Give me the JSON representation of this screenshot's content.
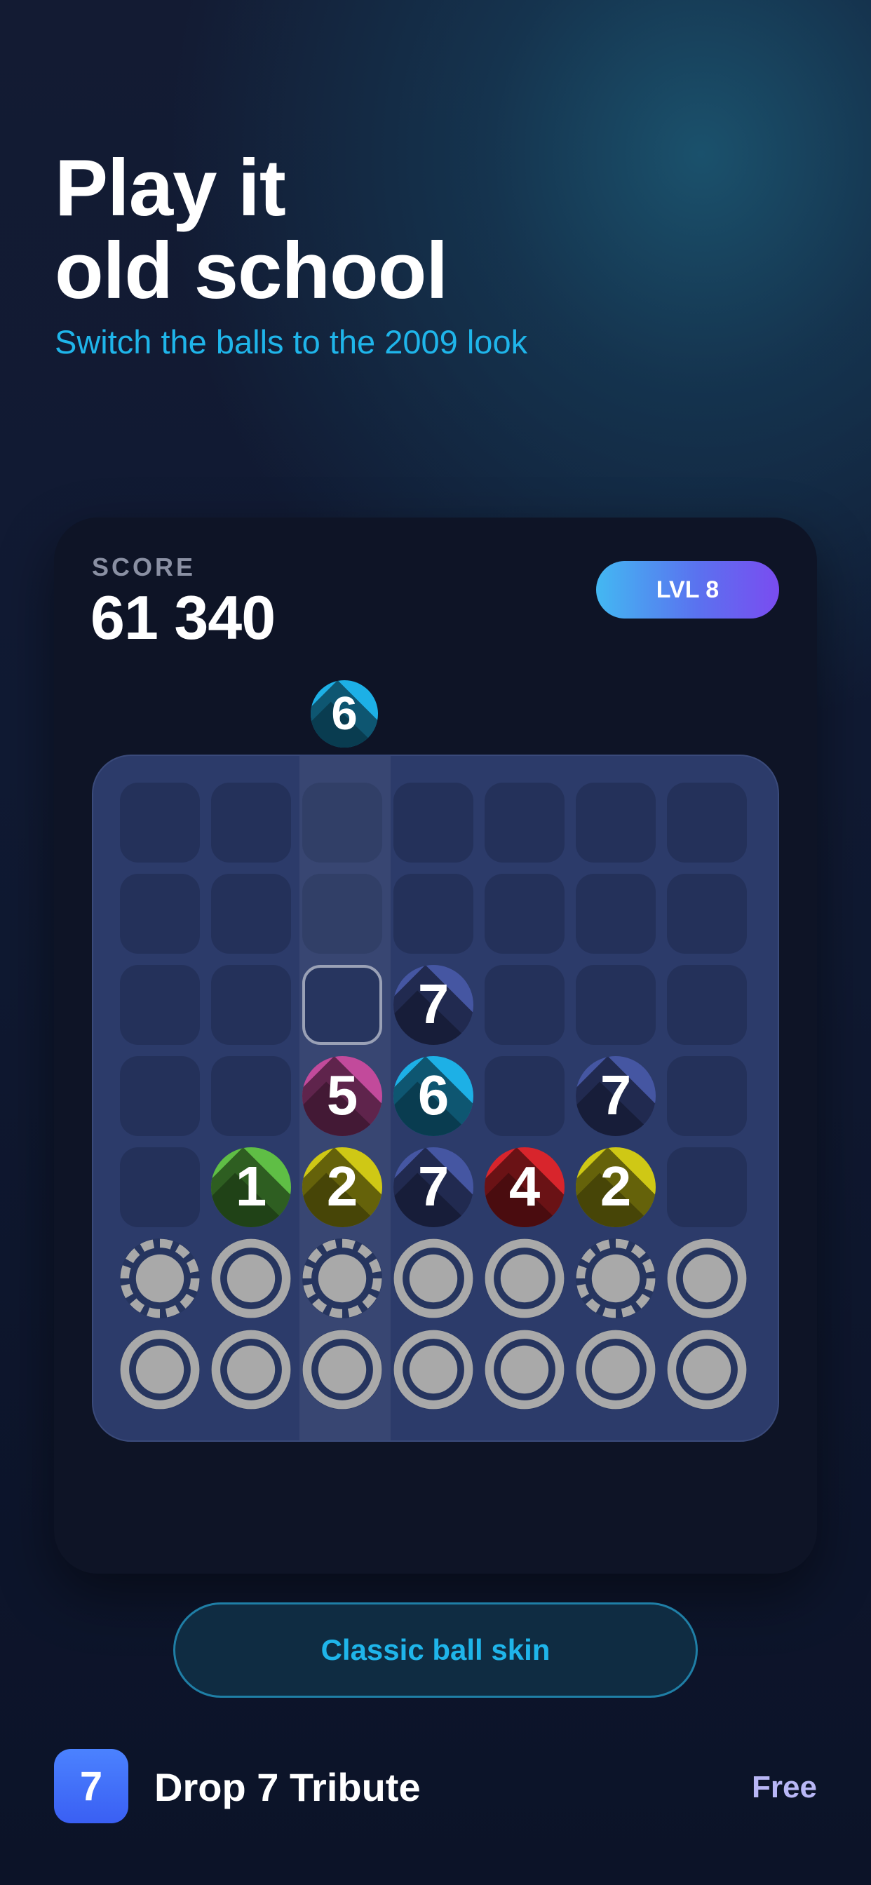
{
  "headline": {
    "line1": "Play it",
    "line2": "old school"
  },
  "subheadline": "Switch the balls to the 2009 look",
  "game": {
    "score_label": "SCORE",
    "score_value": "61 340",
    "level_label": "LVL 8",
    "next_ball": 6,
    "highlighted_column": 2,
    "grid": [
      [
        "empty",
        "empty",
        "empty",
        "empty",
        "empty",
        "empty",
        "empty"
      ],
      [
        "empty",
        "empty",
        "empty",
        "empty",
        "empty",
        "empty",
        "empty"
      ],
      [
        "empty",
        "empty",
        "target",
        7,
        "empty",
        "empty",
        "empty"
      ],
      [
        "empty",
        "empty",
        5,
        6,
        "empty",
        7,
        "empty"
      ],
      [
        "empty",
        1,
        2,
        7,
        4,
        2,
        "empty"
      ],
      [
        "cracked",
        "sealed",
        "cracked",
        "sealed",
        "sealed",
        "cracked",
        "sealed"
      ],
      [
        "sealed",
        "sealed",
        "sealed",
        "sealed",
        "sealed",
        "sealed",
        "sealed"
      ]
    ]
  },
  "ball_colors": {
    "1": "#5fbe45",
    "2": "#cfc815",
    "4": "#d8252c",
    "5": "#c24a9b",
    "6": "#1db0e6",
    "7": "#4556a2"
  },
  "cta_label": "Classic ball skin",
  "footer": {
    "app_icon_text": "7",
    "app_name": "Drop 7 Tribute",
    "price": "Free"
  }
}
